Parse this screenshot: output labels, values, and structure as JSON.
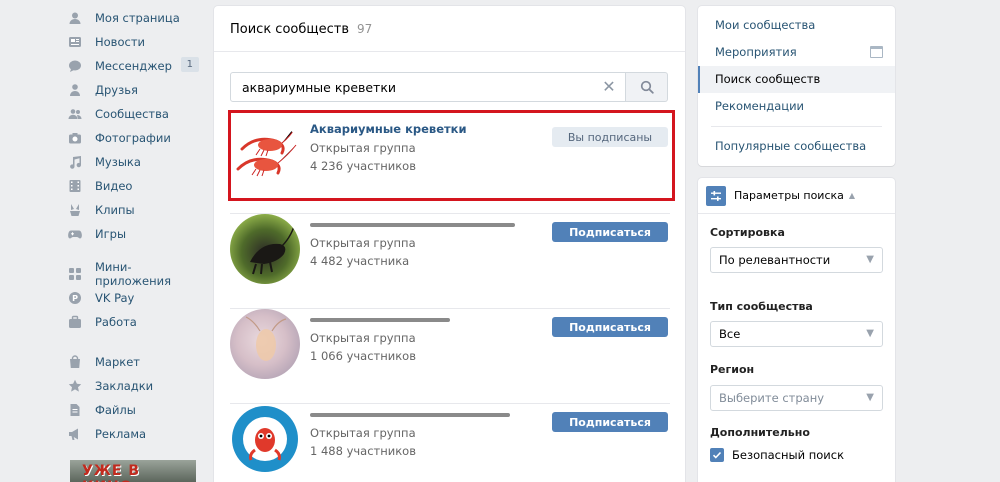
{
  "nav": {
    "items": [
      {
        "label": "Моя страница",
        "icon": "user-icon"
      },
      {
        "label": "Новости",
        "icon": "news-icon"
      },
      {
        "label": "Мессенджер",
        "icon": "messenger-icon",
        "counter": "1"
      },
      {
        "label": "Друзья",
        "icon": "friends-icon"
      },
      {
        "label": "Сообщества",
        "icon": "communities-icon"
      },
      {
        "label": "Фотографии",
        "icon": "camera-icon"
      },
      {
        "label": "Музыка",
        "icon": "music-icon"
      },
      {
        "label": "Видео",
        "icon": "video-icon"
      },
      {
        "label": "Клипы",
        "icon": "clips-icon"
      },
      {
        "label": "Игры",
        "icon": "gamepad-icon"
      },
      {
        "label": "Мини-приложения",
        "icon": "apps-icon"
      },
      {
        "label": "VK Pay",
        "icon": "vkpay-icon"
      },
      {
        "label": "Работа",
        "icon": "work-icon"
      },
      {
        "label": "Маркет",
        "icon": "market-icon"
      },
      {
        "label": "Закладки",
        "icon": "star-icon"
      },
      {
        "label": "Файлы",
        "icon": "files-icon"
      },
      {
        "label": "Реклама",
        "icon": "ads-icon"
      }
    ],
    "promo_text": "УЖЕ В КИНО"
  },
  "main": {
    "title": "Поиск сообществ",
    "count": "97",
    "search": {
      "value": "аквариумные креветки"
    },
    "subscribe_label": "Подписаться",
    "subscribed_label": "Вы подписаны",
    "groups": [
      {
        "name": "Аквариумные креветки",
        "type": "Открытая группа",
        "members": "4 236 участников",
        "subscribed": true
      },
      {
        "name": "",
        "type": "Открытая группа",
        "members": "4 482 участника",
        "subscribed": false
      },
      {
        "name": "",
        "type": "Открытая группа",
        "members": "1 066 участников",
        "subscribed": false
      },
      {
        "name": "",
        "type": "Открытая группа",
        "members": "1 488 участников",
        "subscribed": false
      }
    ]
  },
  "right_menu": {
    "items": [
      "Мои сообщества",
      "Мероприятия",
      "Поиск сообществ",
      "Рекомендации",
      "Популярные сообщества"
    ]
  },
  "filters": {
    "header": "Параметры поиска",
    "sort_label": "Сортировка",
    "sort_value": "По релевантности",
    "type_label": "Тип сообщества",
    "type_value": "Все",
    "region_label": "Регион",
    "region_placeholder": "Выберите страну",
    "extra_label": "Дополнительно",
    "safe_search_label": "Безопасный поиск",
    "safe_search_checked": true
  },
  "colors": {
    "accent": "#5181b8",
    "link": "#2a5885",
    "highlight": "#d4151e",
    "background": "#edeef0"
  }
}
